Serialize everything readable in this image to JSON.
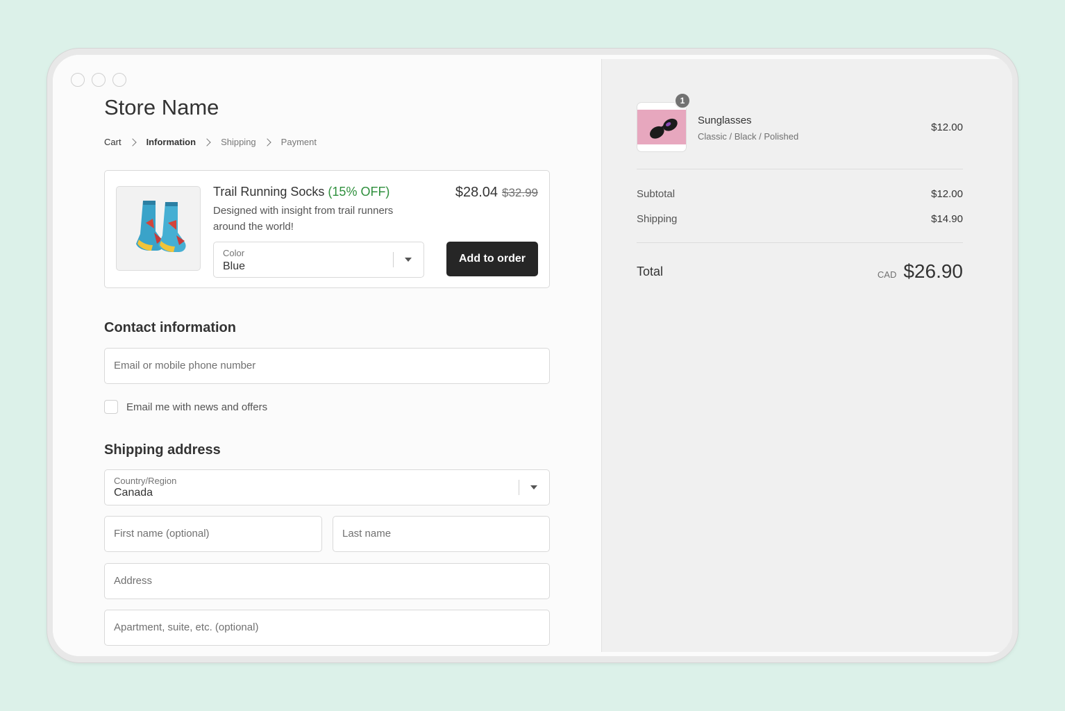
{
  "store_name": "Store Name",
  "breadcrumb": [
    "Cart",
    "Information",
    "Shipping",
    "Payment"
  ],
  "upsell": {
    "title": "Trail Running Socks",
    "discount": "(15% OFF)",
    "description": "Designed with insight from trail runners around the world!",
    "price": "$28.04",
    "compare_price": "$32.99",
    "color_label": "Color",
    "color_value": "Blue",
    "add_button": "Add to order",
    "image_icon": "socks-image",
    "discount_color": "#2e8f3c"
  },
  "contact": {
    "title": "Contact information",
    "email_placeholder": "Email or mobile phone number",
    "news_checkbox_label": "Email me with news and offers"
  },
  "shipping_address": {
    "title": "Shipping address",
    "country_label": "Country/Region",
    "country_value": "Canada",
    "first_name_placeholder": "First name (optional)",
    "last_name_placeholder": "Last name",
    "address_placeholder": "Address",
    "apartment_placeholder": "Apartment, suite, etc. (optional)"
  },
  "summary": {
    "item": {
      "quantity": "1",
      "name": "Sunglasses",
      "variant": "Classic / Black / Polished",
      "price": "$12.00",
      "image_icon": "sunglasses-image"
    },
    "subtotal_label": "Subtotal",
    "subtotal_value": "$12.00",
    "shipping_label": "Shipping",
    "shipping_value": "$14.90",
    "total_label": "Total",
    "total_currency": "CAD",
    "total_value": "$26.90"
  },
  "colors": {
    "button_bg": "#262626",
    "sidebar_bg": "#f0f0f0",
    "page_bg": "#dcf1e9"
  }
}
